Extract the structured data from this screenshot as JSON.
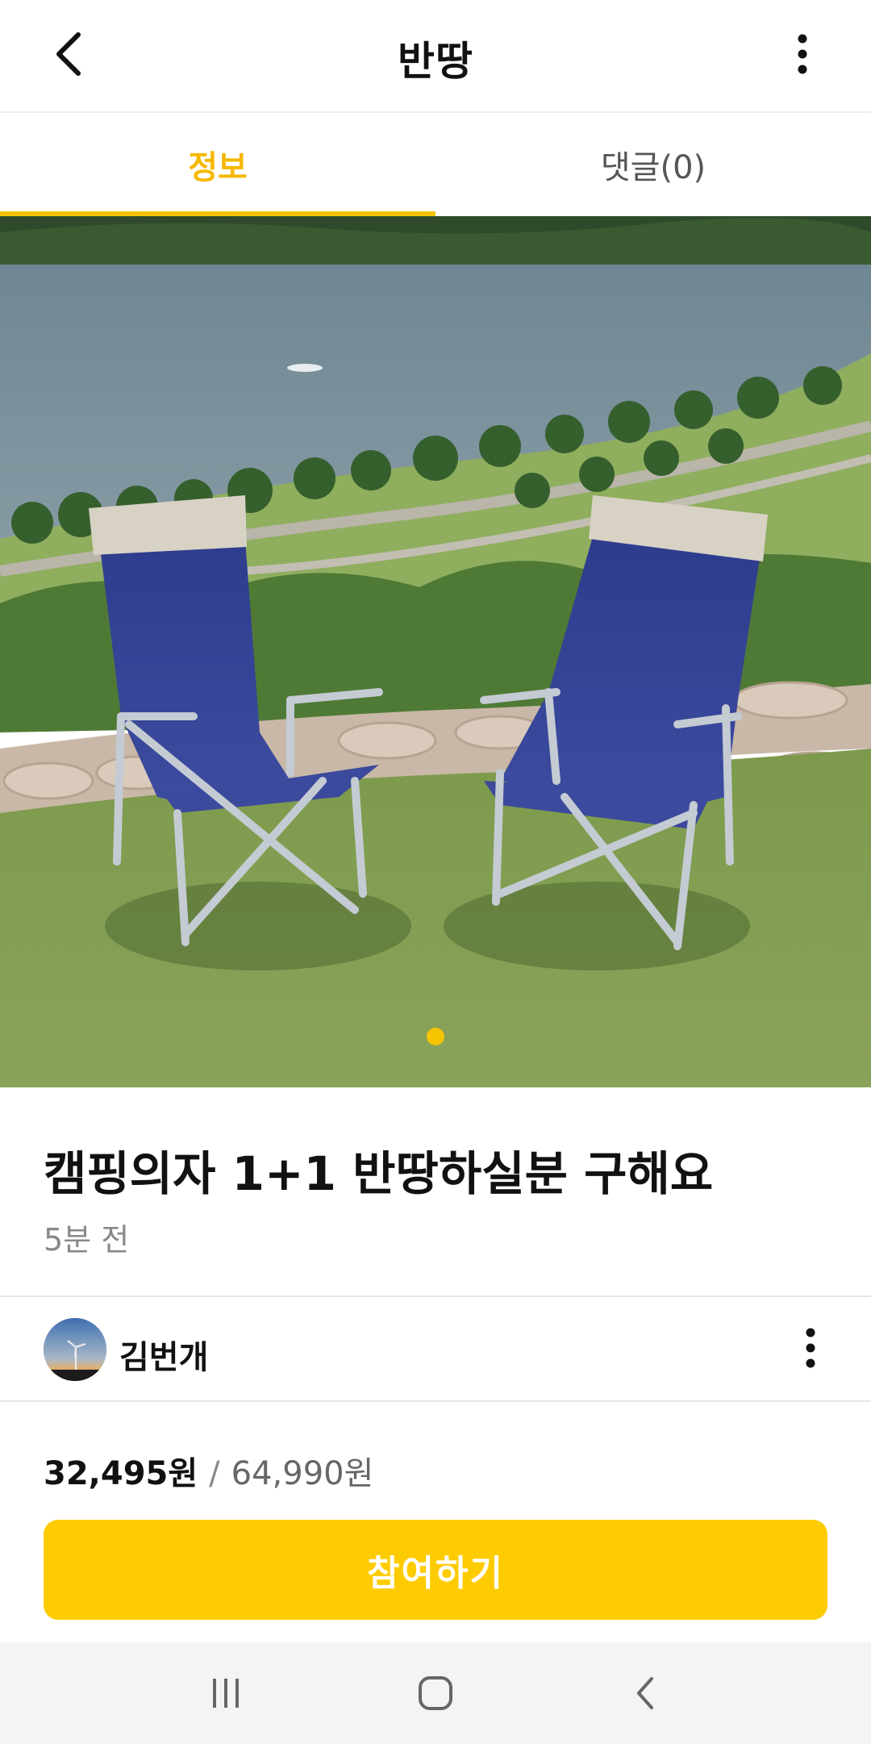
{
  "header": {
    "title": "반땅"
  },
  "tabs": [
    {
      "label": "정보",
      "active": true
    },
    {
      "label": "댓글(0)",
      "active": false
    }
  ],
  "gallery": {
    "image_description_icon": "camping-chairs-photo",
    "page_count": 1,
    "current_page": 1
  },
  "post": {
    "title": "캠핑의자 1+1 반땅하실분 구해요",
    "time": "5분 전"
  },
  "seller": {
    "name": "김번개"
  },
  "price": {
    "per_person": "32,495원",
    "separator": "/",
    "total": "64,990원"
  },
  "cta": {
    "label": "참여하기"
  },
  "colors": {
    "accent": "#fecb00",
    "active_tab": "#f5b800"
  }
}
